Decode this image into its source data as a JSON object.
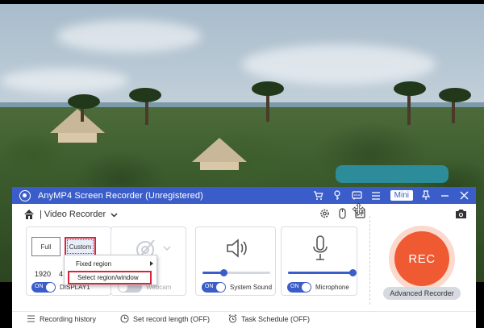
{
  "window": {
    "title": "AnyMP4 Screen Recorder (Unregistered)",
    "mini_label": "Mini",
    "accent": "#3b5dc9",
    "rec_color": "#ef5a33"
  },
  "titlebar_icons": [
    "cart-icon",
    "key-icon",
    "chat-icon",
    "menu-icon",
    "pin-icon",
    "minimize-icon",
    "close-icon"
  ],
  "modebar": {
    "mode_label": "| Video Recorder",
    "icons": [
      "gear-icon",
      "mouse-icon",
      "fps-icon",
      "move-icon",
      "camera-icon"
    ]
  },
  "display_card": {
    "full_label": "Full",
    "custom_label": "Custom",
    "width_value": "1920",
    "height_partial": "4",
    "toggle_label": "ON",
    "display_name": "DISPLAY1"
  },
  "webcam_card": {
    "label": "Webcam",
    "toggle_state": "off"
  },
  "system_sound_card": {
    "toggle_label": "ON",
    "label": "System Sound",
    "volume": 0.32
  },
  "microphone_card": {
    "toggle_label": "ON",
    "label": "Microphone",
    "volume": 1.0
  },
  "rec_button": {
    "label": "REC"
  },
  "advanced_button": {
    "label": "Advanced Recorder"
  },
  "context_menu": {
    "items": [
      {
        "label": "Fixed region",
        "has_submenu": true
      },
      {
        "label": "Select region/window",
        "highlighted": true
      }
    ]
  },
  "bottom_bar": {
    "history": "Recording history",
    "record_length": "Set record length (OFF)",
    "task_schedule": "Task Schedule (OFF)"
  }
}
